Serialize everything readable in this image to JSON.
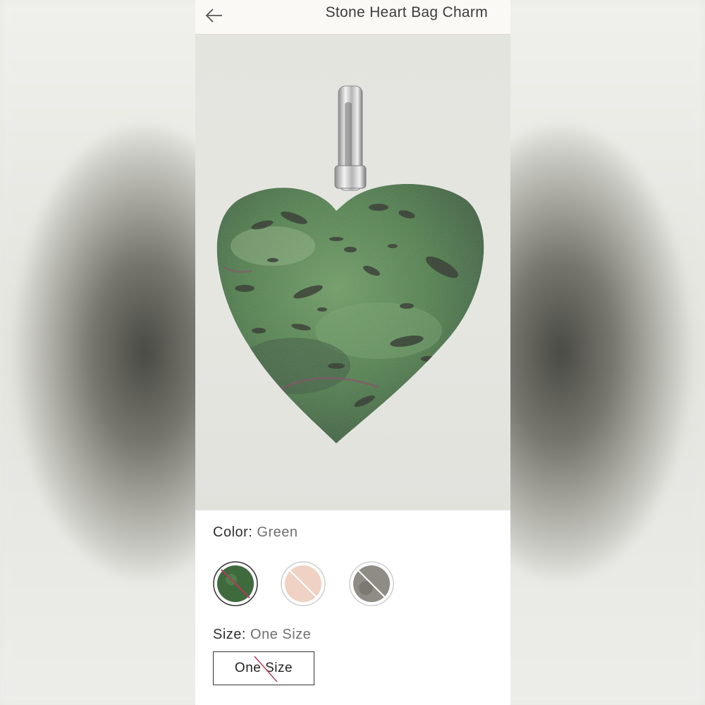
{
  "header": {
    "title": "Stone Heart Bag Charm",
    "back_icon": "arrow-left-icon"
  },
  "product": {
    "image_alt": "stone-heart-pendant",
    "stone_color": "#4f7d52"
  },
  "color_option": {
    "label": "Color:",
    "value": "Green",
    "swatches": [
      {
        "name": "green",
        "color": "#3f6a3e",
        "unavailable": true,
        "selected": true
      },
      {
        "name": "pink",
        "color": "#efd2c3",
        "unavailable": true,
        "selected": false
      },
      {
        "name": "gray",
        "color": "#8f8c86",
        "unavailable": true,
        "selected": false
      }
    ]
  },
  "size_option": {
    "label": "Size:",
    "value": "One Size",
    "button_label": "One Size",
    "unavailable": true
  },
  "colors": {
    "strike": "#b23a5a",
    "border": "#333333"
  }
}
